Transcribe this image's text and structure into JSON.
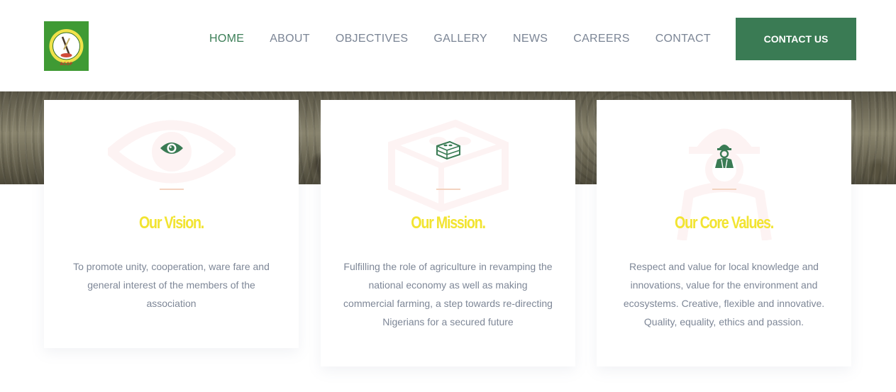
{
  "header": {
    "logo_alt": "ACOF",
    "nav": [
      {
        "label": "HOME",
        "active": true
      },
      {
        "label": "ABOUT",
        "active": false
      },
      {
        "label": "OBJECTIVES",
        "active": false
      },
      {
        "label": "GALLERY",
        "active": false
      },
      {
        "label": "NEWS",
        "active": false
      },
      {
        "label": "CAREERS",
        "active": false
      },
      {
        "label": "CONTACT",
        "active": false
      }
    ],
    "cta_label": "CONTACT US"
  },
  "cards": [
    {
      "icon": "eye-icon",
      "title": "Our Vision.",
      "text": "To promote unity, cooperation, ware fare and general interest of the members of the association"
    },
    {
      "icon": "bricks-icon",
      "title": "Our Mission.",
      "text": "Fulfilling the role of agriculture in revamping the national economy as well as making commercial farming, a step towards re-directing Nigerians for a secured future"
    },
    {
      "icon": "worker-icon",
      "title": "Our Core Values.",
      "text": "Respect and value for local knowledge and innovations, value for the environment and ecosystems. Creative, flexible and innovative. Quality, equality, ethics and passion."
    }
  ],
  "colors": {
    "brand_green": "#3a7b54",
    "nav_active": "#3c7e57",
    "nav_text": "#7b8595",
    "title_yellow": "#f2e431",
    "body_text": "#7e8797",
    "watermark_red": "#e84a4a"
  }
}
